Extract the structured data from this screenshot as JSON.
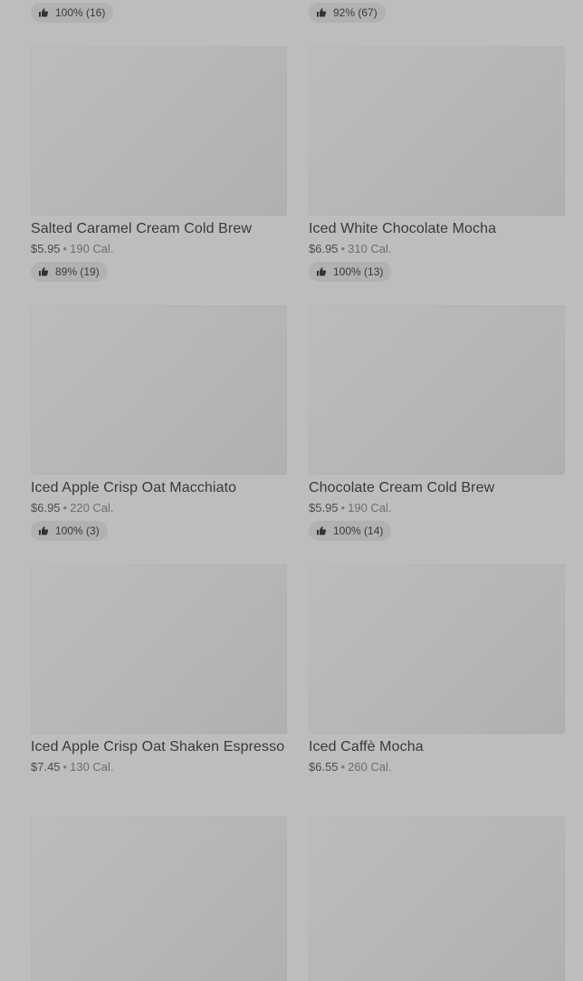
{
  "top_badges": [
    {
      "rating": "100% (16)"
    },
    {
      "rating": "92% (67)"
    }
  ],
  "products": [
    {
      "name": "Salted Caramel Cream Cold Brew",
      "price": "$5.95",
      "calories": "190 Cal.",
      "rating": "89% (19)"
    },
    {
      "name": "Iced White Chocolate Mocha",
      "price": "$6.95",
      "calories": "310 Cal.",
      "rating": "100% (13)"
    },
    {
      "name": "Iced Apple Crisp Oat Macchiato",
      "price": "$6.95",
      "calories": "220 Cal.",
      "rating": "100% (3)"
    },
    {
      "name": "Chocolate Cream Cold Brew",
      "price": "$5.95",
      "calories": "190 Cal.",
      "rating": "100% (14)"
    },
    {
      "name": "Iced Apple Crisp Oat Shaken Espresso",
      "price": "$7.45",
      "calories": "130 Cal.",
      "rating": null
    },
    {
      "name": "Iced Caffè Mocha",
      "price": "$6.55",
      "calories": "260 Cal.",
      "rating": null
    }
  ],
  "separator": "•",
  "icons": {
    "rating": "thumbs-up-icon"
  },
  "colors": {
    "background": "#bdbdbd",
    "badge": "#b1b1b1",
    "thumb": "#b6b6b6"
  }
}
